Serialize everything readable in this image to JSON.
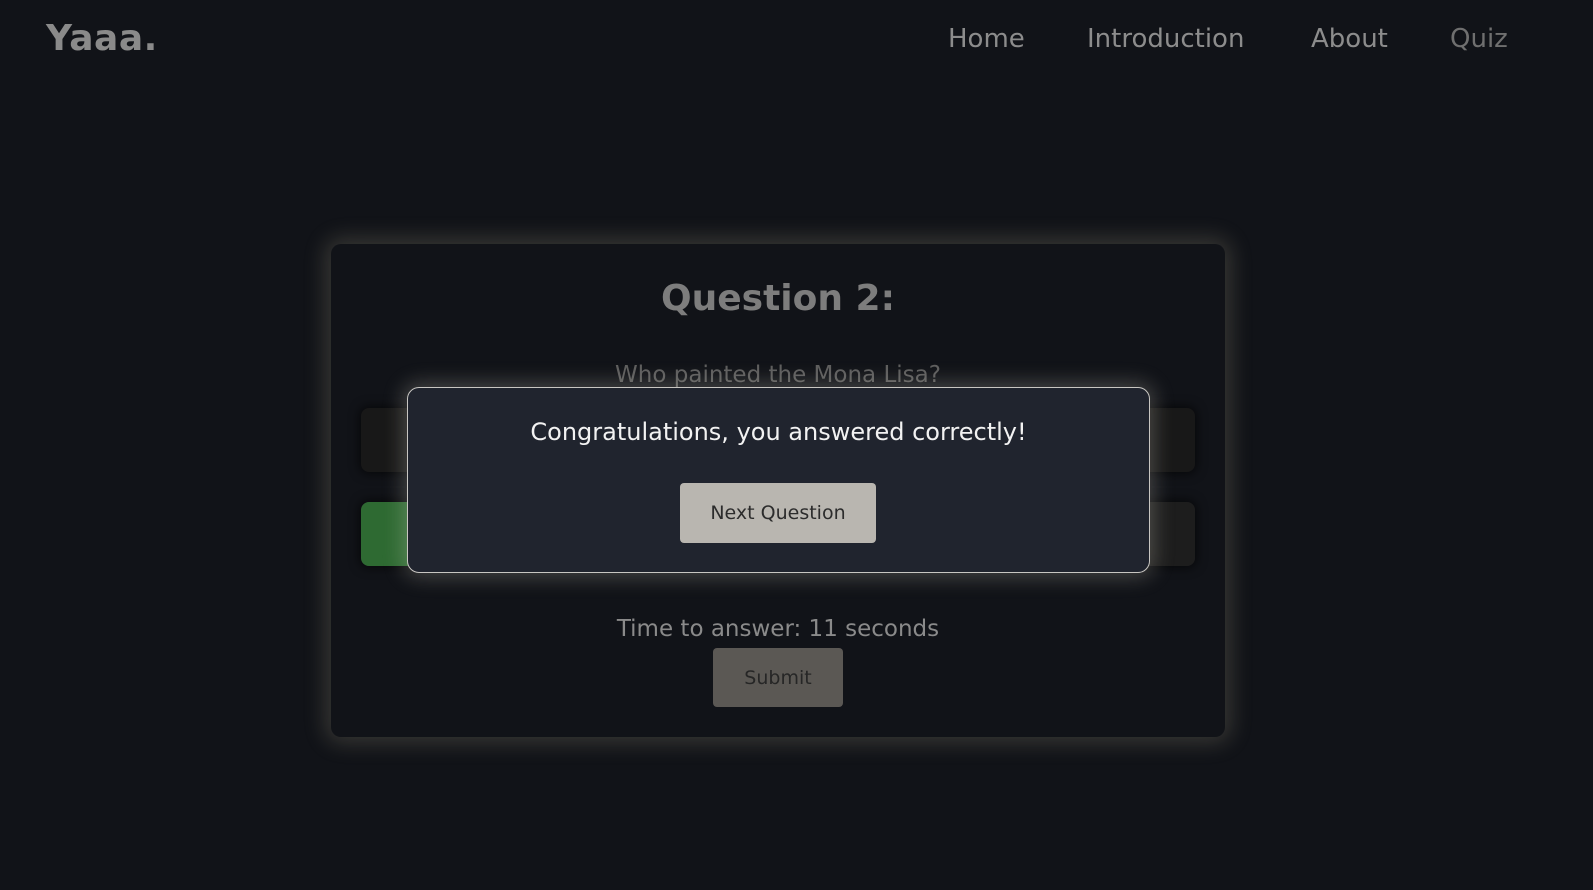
{
  "header": {
    "logo": "Yaaa.",
    "nav": [
      {
        "label": "Home"
      },
      {
        "label": "Introduction"
      },
      {
        "label": "About"
      },
      {
        "label": "Quiz"
      }
    ]
  },
  "quiz": {
    "title": "Question 2:",
    "question": "Who painted the Mona Lisa?",
    "timer_text": "Time to answer: 11 seconds",
    "submit_label": "Submit"
  },
  "modal": {
    "message": "Congratulations, you answered correctly!",
    "next_label": "Next Question"
  },
  "colors": {
    "background": "#111318",
    "correct_option": "#2e6a32",
    "modal_background": "#20242e",
    "next_button": "#b9b6b0"
  }
}
